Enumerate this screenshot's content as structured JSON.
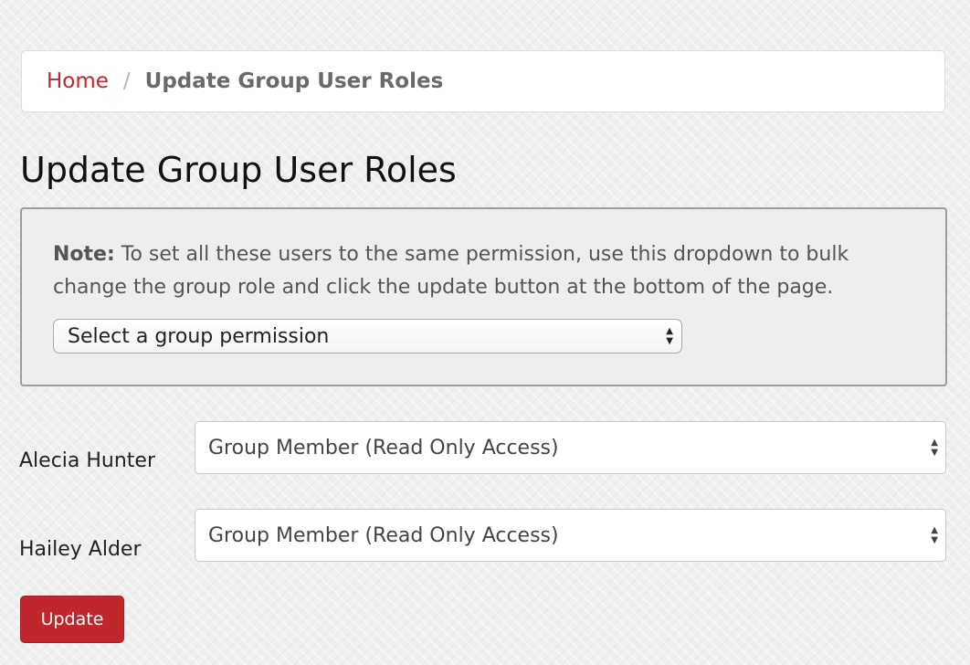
{
  "breadcrumb": {
    "home": "Home",
    "separator": "/",
    "current": "Update Group User Roles"
  },
  "page_title": "Update Group User Roles",
  "note": {
    "label": "Note:",
    "text": " To set all these users to the same permission, use this dropdown to bulk change the group role and click the update button at the bottom of the page.",
    "bulk_select_value": "Select a group permission"
  },
  "users": [
    {
      "name": "Alecia Hunter",
      "role": "Group Member (Read Only Access)"
    },
    {
      "name": "Hailey Alder",
      "role": "Group Member (Read Only Access)"
    }
  ],
  "update_label": "Update",
  "icons": {
    "select_arrows": "up-down-arrows-icon"
  },
  "colors": {
    "accent": "#c0262d",
    "button": "#c0272d",
    "note_background": "#eeeeee"
  }
}
